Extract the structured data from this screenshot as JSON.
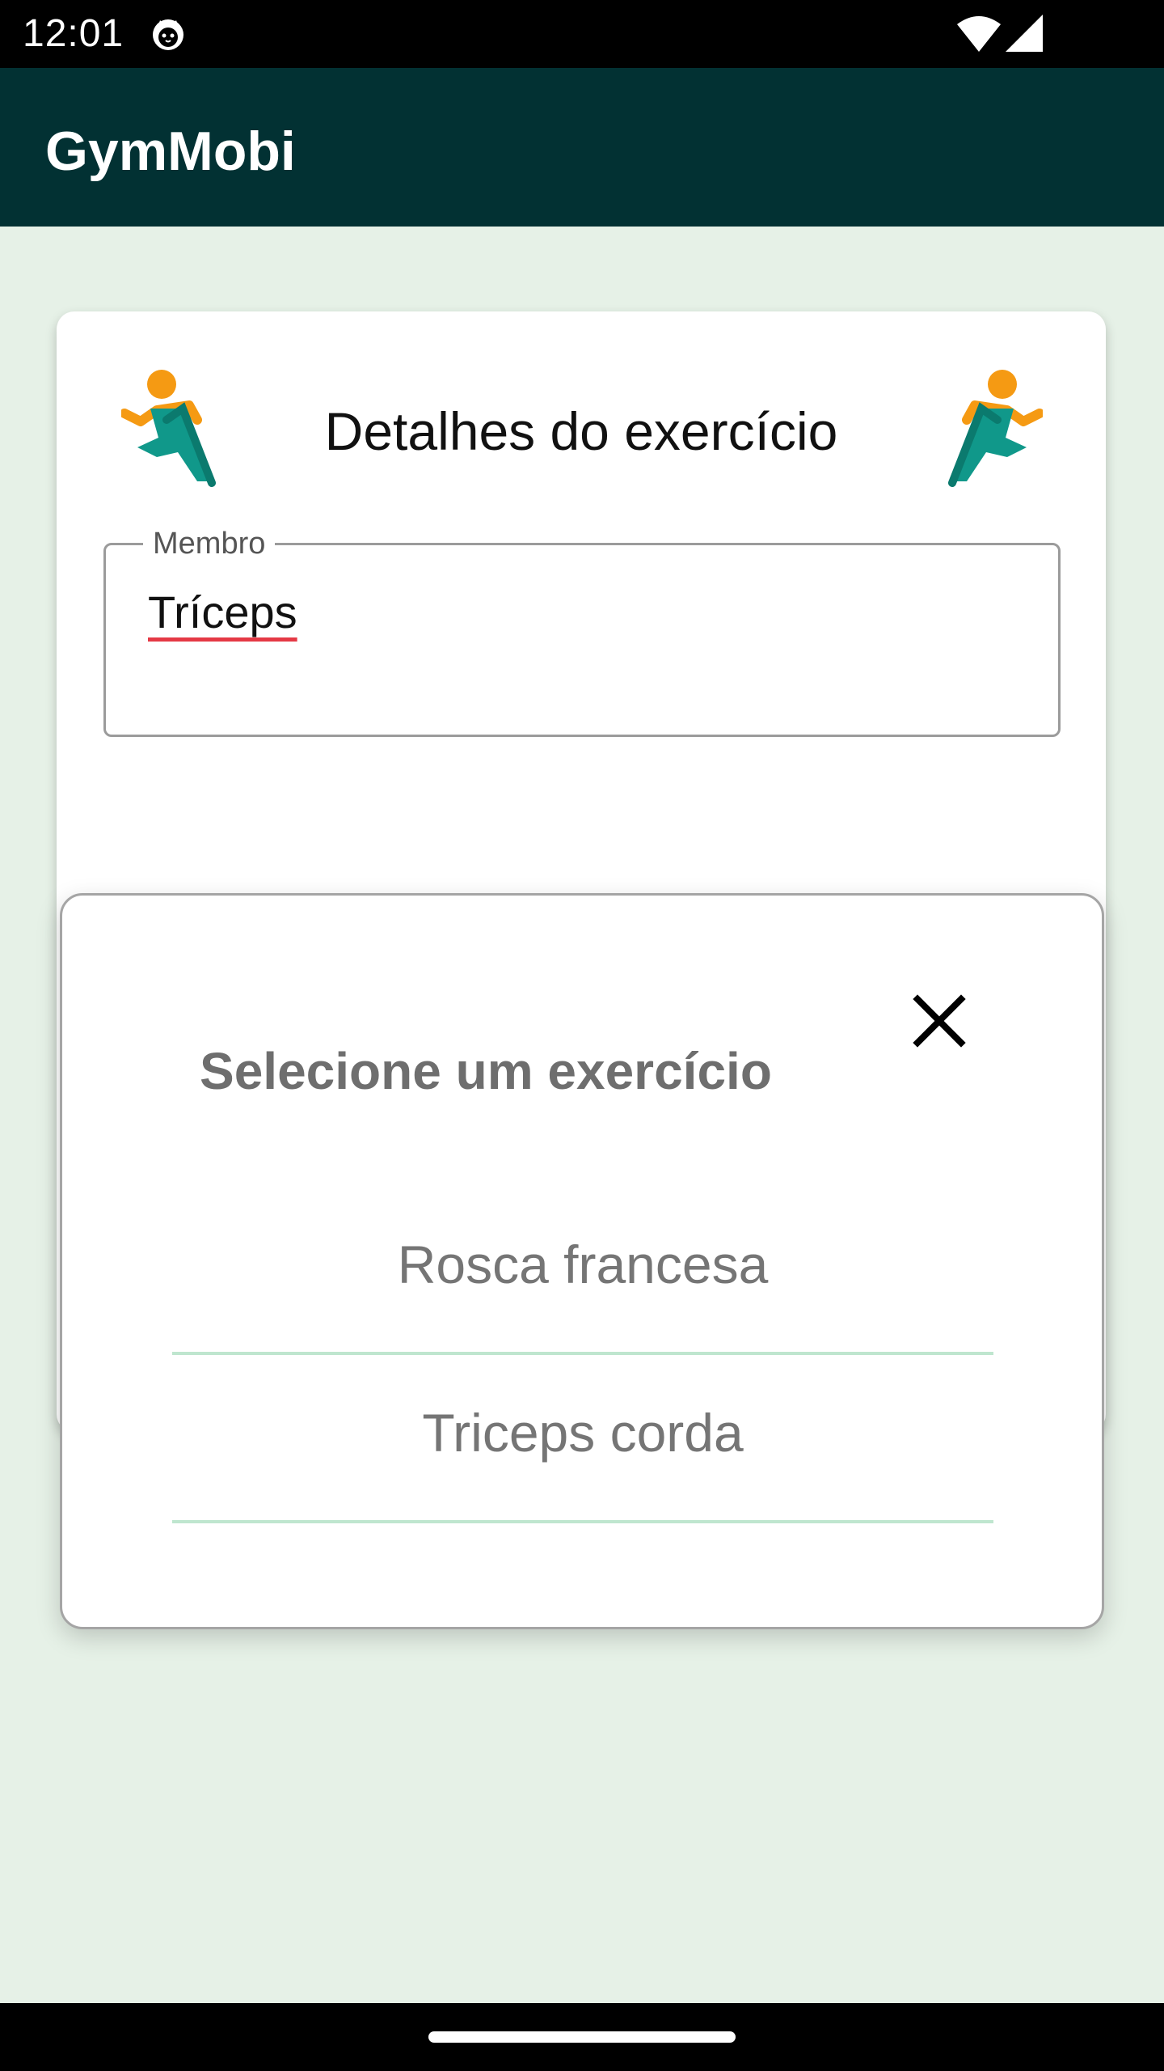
{
  "status_bar": {
    "time": "12:01",
    "icons": [
      "cat-notification-icon",
      "wifi-icon",
      "cellular-signal-icon"
    ]
  },
  "app_bar": {
    "title": "GymMobi",
    "color": "#023133"
  },
  "card": {
    "title": "Detalhes do exercício",
    "icons": [
      "runner-icon",
      "runner-icon"
    ],
    "field": {
      "label": "Membro",
      "value": "Tríceps"
    }
  },
  "dialog": {
    "title": "Selecione um exercício",
    "close_icon": "close-icon",
    "items": [
      {
        "label": "Rosca francesa"
      },
      {
        "label": "Triceps corda"
      }
    ]
  },
  "colors": {
    "background": "#e6f1e7",
    "runner_orange": "#f59a13",
    "runner_teal": "#10988a",
    "divider": "#bfe6cf",
    "spell_underline": "#e53945"
  }
}
